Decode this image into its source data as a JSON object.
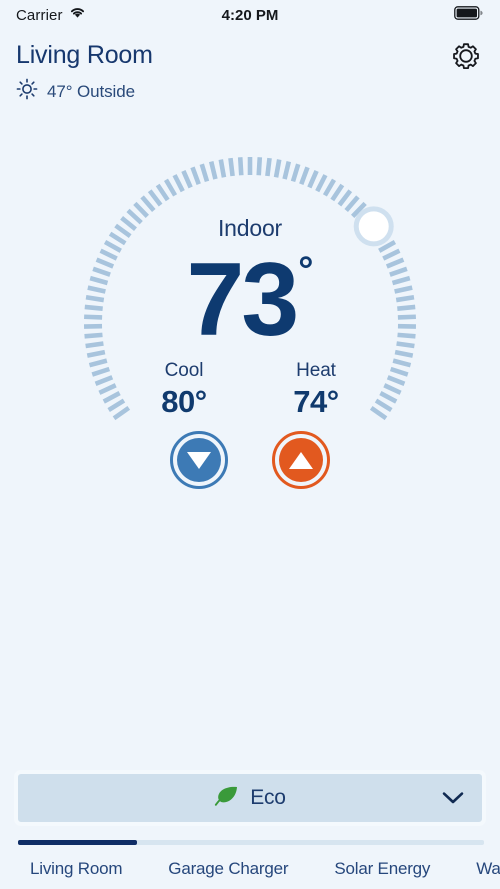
{
  "status_bar": {
    "carrier": "Carrier",
    "wifi_icon": "wifi-icon",
    "time": "4:20 PM",
    "battery_icon": "battery-full-icon"
  },
  "header": {
    "room_title": "Living Room",
    "outside_icon": "sun-icon",
    "outside_text": "47° Outside",
    "settings_icon": "gear-icon"
  },
  "thermostat": {
    "indoor_label": "Indoor",
    "indoor_temp": "73",
    "indoor_degree": "°",
    "dial": {
      "handle_icon": "dial-handle",
      "tick_color": "#a8c4dd",
      "handle_fill": "#ffffff",
      "handle_ring": "#cfe0ef",
      "total_ticks": 74,
      "start_angle_deg": 145,
      "sweep_deg": 250,
      "handle_position_deg": 38
    },
    "cool": {
      "label": "Cool",
      "value": "80°",
      "button_icon": "arrow-down-icon",
      "color": "#3d7ab5"
    },
    "heat": {
      "label": "Heat",
      "value": "74°",
      "button_icon": "arrow-up-icon",
      "color": "#e2591f"
    }
  },
  "eco_selector": {
    "leaf_icon": "leaf-icon",
    "label": "Eco",
    "chevron_icon": "chevron-down-icon",
    "background": "#cfdfec"
  },
  "tabbar": {
    "indicator_fill_color": "#0f2d66",
    "indicator_track_color": "#d7e5f0",
    "tabs": [
      {
        "label": "Living Room",
        "active": true
      },
      {
        "label": "Garage Charger",
        "active": false
      },
      {
        "label": "Solar Energy",
        "active": false
      },
      {
        "label": "Water Hea",
        "active": false
      }
    ]
  },
  "theme": {
    "background": "#eff5fb",
    "navy": "#17386e",
    "accent_cool": "#3d7ab5",
    "accent_heat": "#e2591f",
    "accent_eco": "#3a9a3a"
  }
}
